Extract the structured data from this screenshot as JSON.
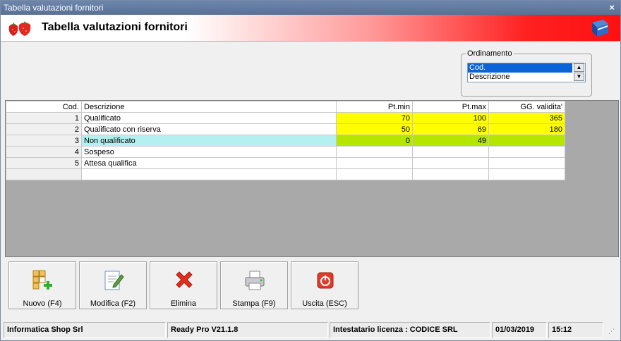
{
  "window": {
    "title": "Tabella valutazioni fornitori",
    "close_label": "×"
  },
  "header": {
    "title": "Tabella valutazioni fornitori",
    "app_icon": "strawberry-icon",
    "help_icon": "book-icon"
  },
  "ordinamento": {
    "legend": "Ordinamento",
    "options": [
      {
        "label": "Cod.",
        "selected": true
      },
      {
        "label": "Descrizione",
        "selected": false
      }
    ]
  },
  "grid": {
    "columns": [
      "Cod.",
      "Descrizione",
      "Pt.min",
      "Pt.max",
      "GG. validita'"
    ],
    "rows": [
      {
        "cod": "1",
        "desc": "Qualificato",
        "ptmin": "70",
        "ptmax": "100",
        "gg": "365"
      },
      {
        "cod": "2",
        "desc": "Qualificato con riserva",
        "ptmin": "50",
        "ptmax": "69",
        "gg": "180"
      },
      {
        "cod": "3",
        "desc": "Non qualificato",
        "ptmin": "0",
        "ptmax": "49",
        "gg": ""
      },
      {
        "cod": "4",
        "desc": "Sospeso",
        "ptmin": "",
        "ptmax": "",
        "gg": ""
      },
      {
        "cod": "5",
        "desc": "Attesa qualifica",
        "ptmin": "",
        "ptmax": "",
        "gg": ""
      }
    ],
    "colors": {
      "yellow": "#ffff00",
      "green": "#b4e600",
      "cyan": "#b4f0f0"
    }
  },
  "toolbar": {
    "nuovo": "Nuovo (F4)",
    "modifica": "Modifica (F2)",
    "elimina": "Elimina",
    "stampa": "Stampa (F9)",
    "uscita": "Uscita (ESC)"
  },
  "status": {
    "company": "Informatica Shop Srl",
    "version": "Ready Pro V21.1.8",
    "license": "Intestatario licenza : CODICE SRL",
    "date": "01/03/2019",
    "time": "15:12"
  }
}
